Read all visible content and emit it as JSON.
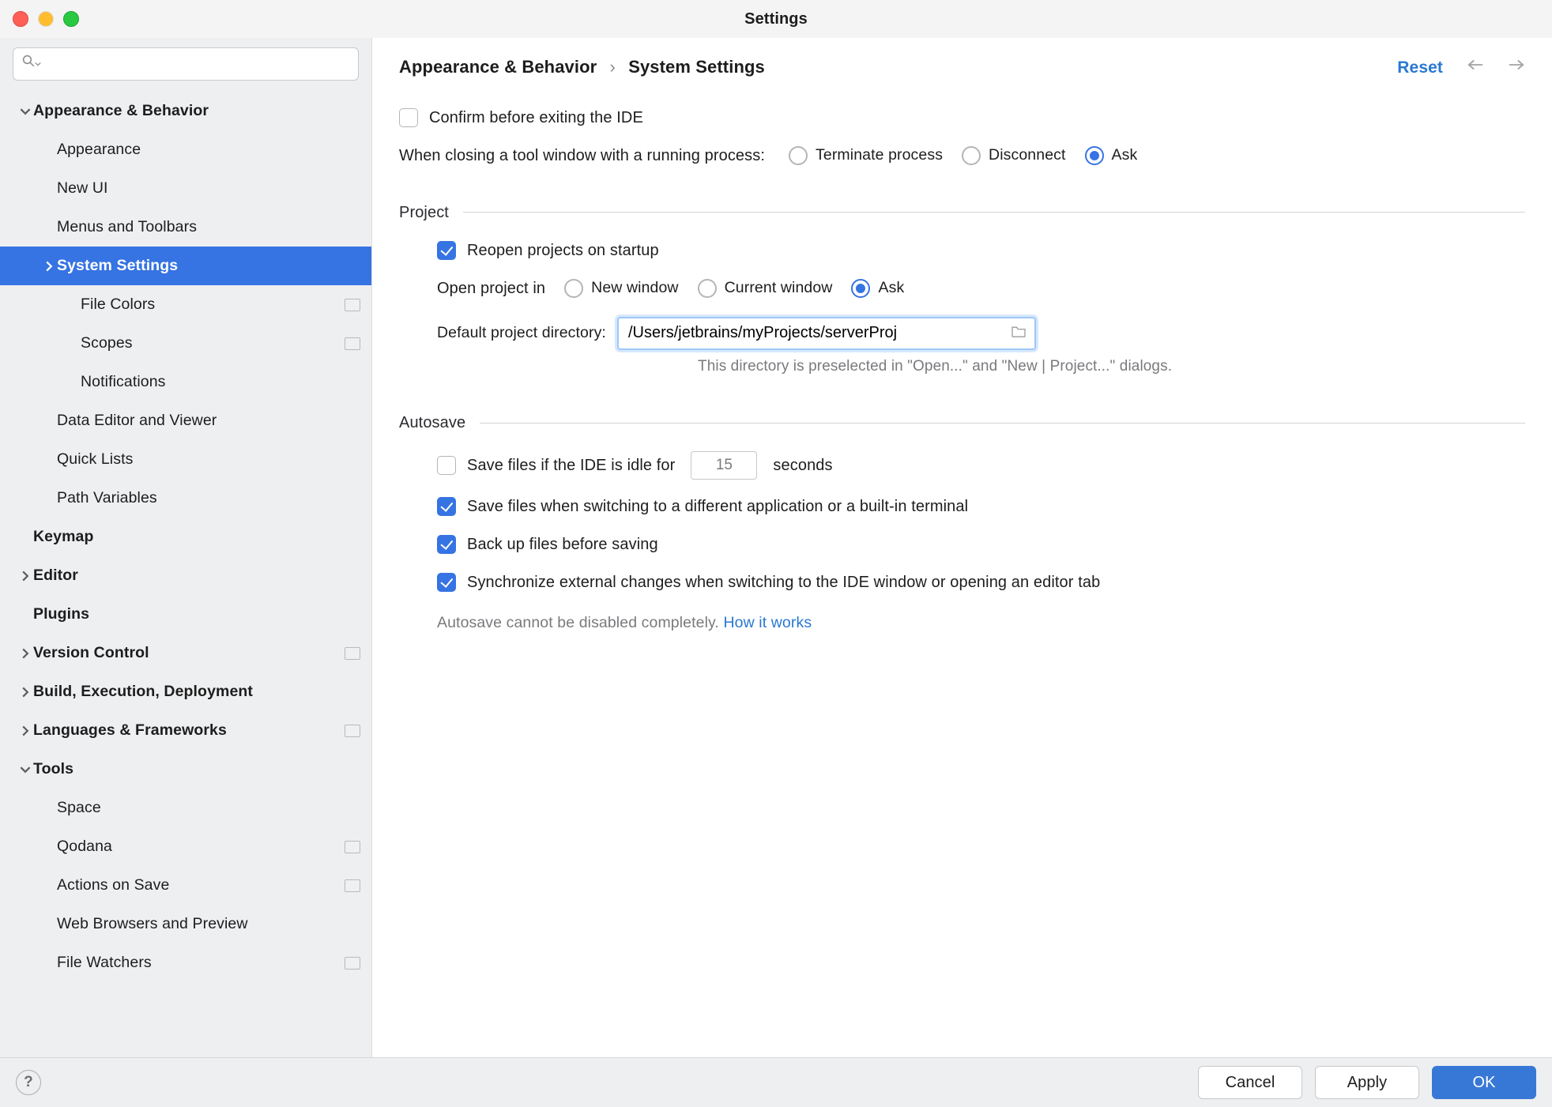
{
  "window": {
    "title": "Settings"
  },
  "sidebar": {
    "search_placeholder": "",
    "items": [
      {
        "label": "Appearance & Behavior",
        "level": 0,
        "arrow": "down",
        "bold": true
      },
      {
        "label": "Appearance",
        "level": 1,
        "arrow": "none"
      },
      {
        "label": "New UI",
        "level": 1,
        "arrow": "none"
      },
      {
        "label": "Menus and Toolbars",
        "level": 1,
        "arrow": "none"
      },
      {
        "label": "System Settings",
        "level": 1,
        "arrow": "right",
        "selected": true,
        "bold": true
      },
      {
        "label": "File Colors",
        "level": 2,
        "arrow": "none",
        "mark": true
      },
      {
        "label": "Scopes",
        "level": 2,
        "arrow": "none",
        "mark": true
      },
      {
        "label": "Notifications",
        "level": 2,
        "arrow": "none"
      },
      {
        "label": "Data Editor and Viewer",
        "level": 1,
        "arrow": "none"
      },
      {
        "label": "Quick Lists",
        "level": 1,
        "arrow": "none"
      },
      {
        "label": "Path Variables",
        "level": 1,
        "arrow": "none"
      },
      {
        "label": "Keymap",
        "level": 0,
        "arrow": "none-pad",
        "bold": true
      },
      {
        "label": "Editor",
        "level": 0,
        "arrow": "right",
        "bold": true
      },
      {
        "label": "Plugins",
        "level": 0,
        "arrow": "none-pad",
        "bold": true
      },
      {
        "label": "Version Control",
        "level": 0,
        "arrow": "right",
        "bold": true,
        "mark": true
      },
      {
        "label": "Build, Execution, Deployment",
        "level": 0,
        "arrow": "right",
        "bold": true
      },
      {
        "label": "Languages & Frameworks",
        "level": 0,
        "arrow": "right",
        "bold": true,
        "mark": true
      },
      {
        "label": "Tools",
        "level": 0,
        "arrow": "down",
        "bold": true
      },
      {
        "label": "Space",
        "level": 1,
        "arrow": "none"
      },
      {
        "label": "Qodana",
        "level": 1,
        "arrow": "none",
        "mark": true
      },
      {
        "label": "Actions on Save",
        "level": 1,
        "arrow": "none",
        "mark": true
      },
      {
        "label": "Web Browsers and Preview",
        "level": 1,
        "arrow": "none"
      },
      {
        "label": "File Watchers",
        "level": 1,
        "arrow": "none",
        "mark": true
      }
    ]
  },
  "header": {
    "breadcrumb1": "Appearance & Behavior",
    "breadcrumb2": "System Settings",
    "sep": "›",
    "reset": "Reset"
  },
  "general": {
    "confirmExit": {
      "checked": false,
      "label": "Confirm before exiting the IDE"
    },
    "closingToolWindowLabel": "When closing a tool window with a running process:",
    "closingToolWindow": {
      "options": [
        {
          "label": "Terminate process",
          "checked": false
        },
        {
          "label": "Disconnect",
          "checked": false
        },
        {
          "label": "Ask",
          "checked": true
        }
      ]
    }
  },
  "project": {
    "title": "Project",
    "reopen": {
      "checked": true,
      "label": "Reopen projects on startup"
    },
    "openInLabel": "Open project in",
    "openIn": {
      "options": [
        {
          "label": "New window",
          "checked": false
        },
        {
          "label": "Current window",
          "checked": false
        },
        {
          "label": "Ask",
          "checked": true
        }
      ]
    },
    "defaultDirLabel": "Default project directory:",
    "defaultDirValue": "/Users/jetbrains/myProjects/serverProj",
    "defaultDirHint": "This directory is preselected in \"Open...\" and \"New | Project...\" dialogs."
  },
  "autosave": {
    "title": "Autosave",
    "idle": {
      "checked": false,
      "label_before": "Save files if the IDE is idle for",
      "value": "15",
      "label_after": "seconds"
    },
    "switching": {
      "checked": true,
      "label": "Save files when switching to a different application or a built-in terminal"
    },
    "backup": {
      "checked": true,
      "label": "Back up files before saving"
    },
    "sync": {
      "checked": true,
      "label": "Synchronize external changes when switching to the IDE window or opening an editor tab"
    },
    "hint_text": "Autosave cannot be disabled completely. ",
    "hint_link": "How it works"
  },
  "footer": {
    "cancel": "Cancel",
    "apply": "Apply",
    "ok": "OK"
  }
}
